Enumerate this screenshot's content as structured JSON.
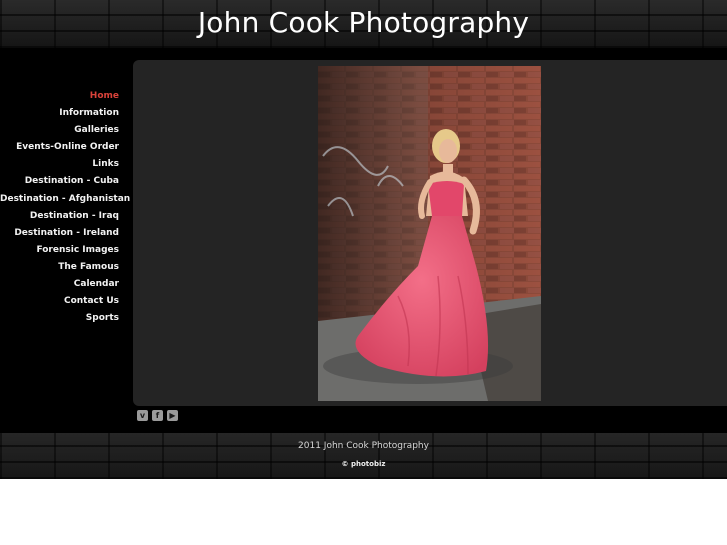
{
  "header": {
    "title": "John Cook Photography"
  },
  "nav": {
    "items": [
      {
        "label": "Home",
        "active": true
      },
      {
        "label": "Information"
      },
      {
        "label": "Galleries"
      },
      {
        "label": "Events-Online Order"
      },
      {
        "label": "Links"
      },
      {
        "label": "Destination - Cuba"
      },
      {
        "label": "Destination - Afghanistan"
      },
      {
        "label": "Destination - Iraq"
      },
      {
        "label": "Destination - Ireland"
      },
      {
        "label": "Forensic Images"
      },
      {
        "label": "The Famous"
      },
      {
        "label": "Calendar"
      },
      {
        "label": "Contact Us"
      },
      {
        "label": "Sports"
      }
    ],
    "active_color": "#d9423a"
  },
  "social": {
    "icons": [
      {
        "name": "vimeo-icon",
        "glyph": "v"
      },
      {
        "name": "facebook-icon",
        "glyph": "f"
      },
      {
        "name": "youtube-icon",
        "glyph": "▶"
      }
    ]
  },
  "footer": {
    "copyright": "2011 John Cook Photography",
    "credit": "© photobiz"
  }
}
